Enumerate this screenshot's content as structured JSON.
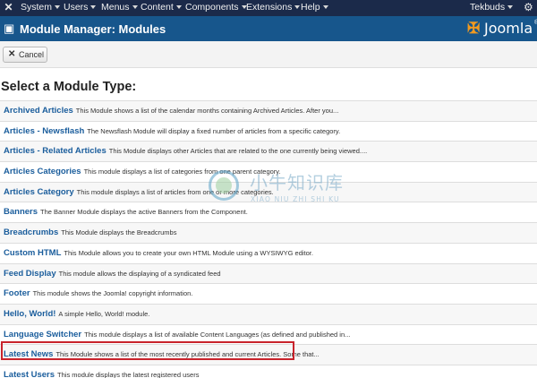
{
  "navbar": {
    "logo_glyph": "✕",
    "menus": [
      {
        "label": "System"
      },
      {
        "label": "Users"
      },
      {
        "label": "Menus"
      },
      {
        "label": "Content"
      },
      {
        "label": "Components"
      },
      {
        "label": "Extensions"
      },
      {
        "label": "Help"
      }
    ],
    "user": {
      "label": "Tekbuds"
    },
    "gear_glyph": "⚙",
    "bg_color": "#1b2a4a"
  },
  "subhead": {
    "title": "Module Manager: Modules",
    "brand": "Joomla",
    "brand_reg": "®",
    "bg_color": "#17568c"
  },
  "toolbar": {
    "cancel_label": "Cancel",
    "cancel_icon": "✕"
  },
  "page": {
    "heading": "Select a Module Type:"
  },
  "modules": [
    {
      "name": "Archived Articles",
      "desc": "This Module shows a list of the calendar months containing Archived Articles. After you..."
    },
    {
      "name": "Articles - Newsflash",
      "desc": "The Newsflash Module will display a fixed number of articles from a specific category."
    },
    {
      "name": "Articles - Related Articles",
      "desc": "This Module displays other Articles that are related to the one currently being viewed...."
    },
    {
      "name": "Articles Categories",
      "desc": "This module displays a list of categories from one parent category."
    },
    {
      "name": "Articles Category",
      "desc": "This module displays a list of articles from one or more categories."
    },
    {
      "name": "Banners",
      "desc": "The Banner Module displays the active Banners from the Component."
    },
    {
      "name": "Breadcrumbs",
      "desc": "This Module displays the Breadcrumbs"
    },
    {
      "name": "Custom HTML",
      "desc": "This Module allows you to create your own HTML Module using a WYSIWYG editor."
    },
    {
      "name": "Feed Display",
      "desc": "This module allows the displaying of a syndicated feed"
    },
    {
      "name": "Footer",
      "desc": "This module shows the Joomla! copyright information."
    },
    {
      "name": "Hello, World!",
      "desc": "A simple Hello, World! module."
    },
    {
      "name": "Language Switcher",
      "desc": "This module displays a list of available Content Languages (as defined and published in..."
    },
    {
      "name": "Latest News",
      "desc": "This Module shows a list of the most recently published and current Articles. Some that..."
    },
    {
      "name": "Latest Users",
      "desc": "This module displays the latest registered users"
    }
  ],
  "highlight_color": "#c8232c",
  "watermark": {
    "text": "小牛知识库",
    "pinyin": "XIAO NIU ZHI SHI KU"
  }
}
